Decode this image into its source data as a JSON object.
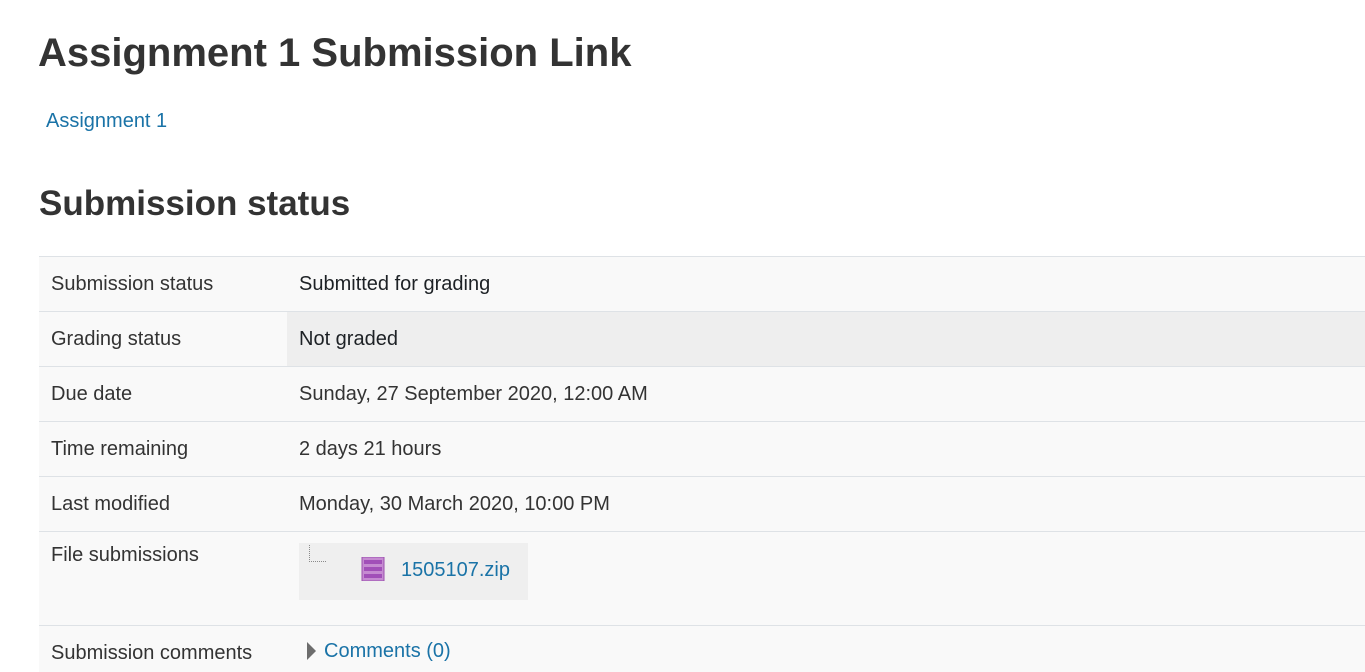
{
  "page": {
    "title": "Assignment 1 Submission Link",
    "assignment_link": "Assignment 1"
  },
  "section": {
    "title": "Submission status"
  },
  "status_rows": [
    {
      "label": "Submission status",
      "value": "Submitted for grading"
    },
    {
      "label": "Grading status",
      "value": "Not graded"
    },
    {
      "label": "Due date",
      "value": "Sunday, 27 September 2020, 12:00 AM"
    },
    {
      "label": "Time remaining",
      "value": "2 days 21 hours"
    },
    {
      "label": "Last modified",
      "value": "Monday, 30 March 2020, 10:00 PM"
    },
    {
      "label": "File submissions",
      "file": "1505107.zip",
      "file_icon": "zip-file-icon"
    },
    {
      "label": "Submission comments",
      "value": "Comments (0)",
      "icon": "caret-right-icon"
    }
  ],
  "colors": {
    "link": "#1a73a7",
    "row_bg": "#f9f9f9",
    "highlight_bg": "#eeeeee",
    "zip_icon": "#b967c7"
  }
}
